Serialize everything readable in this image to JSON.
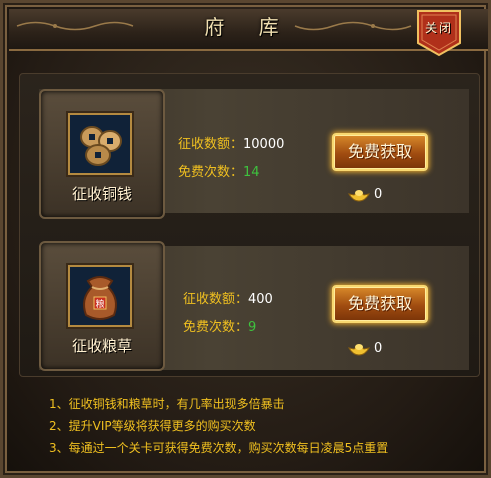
{
  "window": {
    "title": "府 库",
    "close_label": "关闭"
  },
  "items": [
    {
      "name": "征收铜钱",
      "icon": "copper-coins-icon",
      "amount_label": "征收数额：",
      "amount_value": "10000",
      "free_label": "免费次数：",
      "free_value": "14",
      "button_label": "免费获取",
      "ingot_count": "0"
    },
    {
      "name": "征收粮草",
      "icon": "grain-sack-icon",
      "amount_label": "征收数额：",
      "amount_value": "400",
      "free_label": "免费次数：",
      "free_value": "9",
      "button_label": "免费获取",
      "ingot_count": "0"
    }
  ],
  "tips": [
    "1、征收铜钱和粮草时，有几率出现多倍暴击",
    "2、提升VIP等级将获得更多的购买次数",
    "3、每通过一个关卡可获得免费次数，购买次数每日凌晨5点重置"
  ],
  "colors": {
    "label_gold": "#f0c020",
    "value_green": "#3ec23e",
    "button_orange": "#a04c10",
    "close_red": "#b0301a"
  }
}
